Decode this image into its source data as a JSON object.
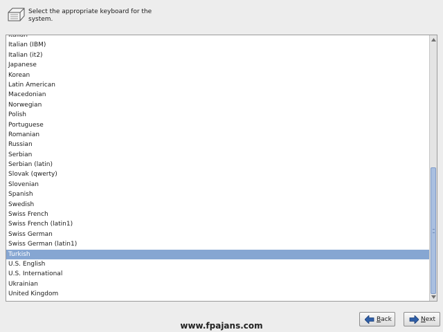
{
  "header": {
    "instruction": "Select the appropriate keyboard for the system."
  },
  "keyboard_list": {
    "items": [
      "Italian",
      "Italian (IBM)",
      "Italian (it2)",
      "Japanese",
      "Korean",
      "Latin American",
      "Macedonian",
      "Norwegian",
      "Polish",
      "Portuguese",
      "Romanian",
      "Russian",
      "Serbian",
      "Serbian (latin)",
      "Slovak (qwerty)",
      "Slovenian",
      "Spanish",
      "Swedish",
      "Swiss French",
      "Swiss French (latin1)",
      "Swiss German",
      "Swiss German (latin1)",
      "Turkish",
      "U.S. English",
      "U.S. International",
      "Ukrainian",
      "United Kingdom"
    ],
    "selected": "Turkish"
  },
  "buttons": {
    "back": {
      "mnemonic": "B",
      "rest": "ack"
    },
    "next": {
      "mnemonic": "N",
      "rest": "ext"
    }
  },
  "watermark": "www.fpajans.com",
  "icons": {
    "keyboard": "keyboard-icon",
    "back": "back-arrow-icon",
    "next": "next-arrow-icon"
  },
  "colors": {
    "selection": "#86a6d2",
    "scroll_thumb": "#a9bfe0",
    "button_icon": "#2f5fa8"
  }
}
